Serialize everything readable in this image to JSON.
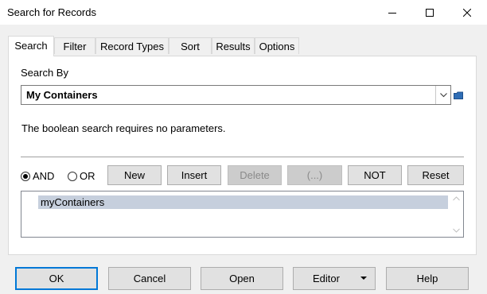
{
  "window": {
    "title": "Search for Records",
    "controls": [
      "minimize-icon",
      "maximize-icon",
      "close-icon"
    ]
  },
  "tabs": [
    {
      "label": "Search",
      "active": true
    },
    {
      "label": "Filter",
      "active": false
    },
    {
      "label": "Record Types",
      "active": false
    },
    {
      "label": "Sort",
      "active": false
    },
    {
      "label": "Results",
      "active": false
    },
    {
      "label": "Options",
      "active": false
    }
  ],
  "search": {
    "search_by_label": "Search By",
    "selected_method": "My Containers",
    "info_text": "The boolean search requires no parameters.",
    "operator": {
      "and_label": "AND",
      "or_label": "OR",
      "selected": "AND"
    },
    "buttons": {
      "new": "New",
      "insert": "Insert",
      "delete": "Delete",
      "ellipsis": "(...)",
      "not": "NOT",
      "reset": "Reset"
    },
    "clauses": [
      "myContainers"
    ]
  },
  "footer": {
    "ok": "OK",
    "cancel": "Cancel",
    "open": "Open",
    "editor": "Editor",
    "help": "Help"
  },
  "colors": {
    "accent": "#0078d7",
    "selection": "#c6cfdd"
  }
}
